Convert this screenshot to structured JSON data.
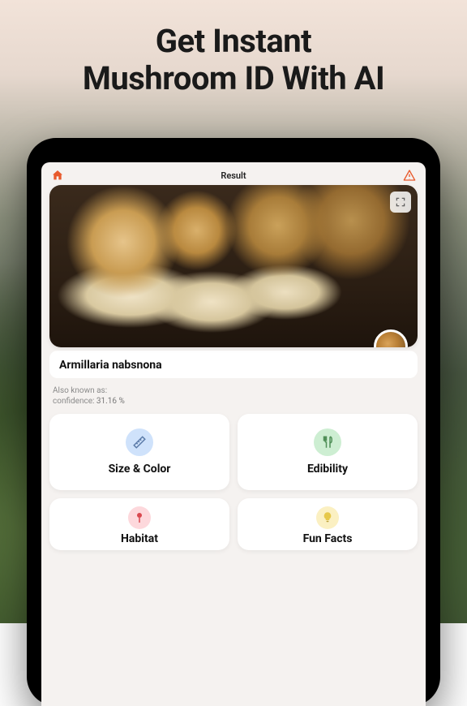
{
  "hero": {
    "line1": "Get Instant",
    "line2": "Mushroom ID With AI"
  },
  "topbar": {
    "title": "Result"
  },
  "result": {
    "species_name": "Armillaria nabsnona",
    "also_known_label": "Also known as:",
    "confidence_label": "confidence:",
    "confidence_value": "31.16 %"
  },
  "tiles": [
    {
      "label": "Size & Color",
      "icon": "ruler-icon",
      "color": "blue"
    },
    {
      "label": "Edibility",
      "icon": "utensils-icon",
      "color": "green"
    },
    {
      "label": "Habitat",
      "icon": "pin-icon",
      "color": "pink"
    },
    {
      "label": "Fun Facts",
      "icon": "bulb-icon",
      "color": "yellow"
    }
  ]
}
